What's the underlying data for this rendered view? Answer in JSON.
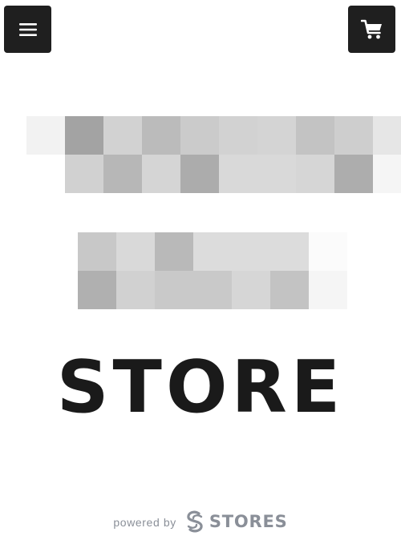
{
  "header": {
    "menu_icon": "hamburger-menu-icon",
    "cart_icon": "shopping-cart-icon"
  },
  "blurred_banner": {
    "rows_top": [
      [
        "#f2f2f2",
        "#a3a3a3",
        "#d2d2d2",
        "#bbbbbb",
        "#cbcbcb",
        "#d2d2d2",
        "#d4d4d4",
        "#c3c3c3",
        "#cecece",
        "#e6e6e6"
      ],
      [
        "#ffffff",
        "#d1d1d1",
        "#b7b7b7",
        "#d5d5d5",
        "#acacac",
        "#d9d9d9",
        "#d9d9d9",
        "#d6d6d6",
        "#adadad",
        "#f5f5f5"
      ]
    ],
    "rows_bottom": [
      [
        "#c8c8c8",
        "#d9d9d9",
        "#b9b9b9",
        "#dcdcdc",
        "#dcdcdc",
        "#dcdcdc",
        "#fbfbfb"
      ],
      [
        "#b0b0b0",
        "#d1d1d1",
        "#c9c9c9",
        "#c9c9c9",
        "#d6d6d6",
        "#c3c3c3",
        "#f5f5f5"
      ]
    ]
  },
  "main": {
    "store_title": "STORE"
  },
  "footer": {
    "powered_by": "powered by",
    "brand_name": "STORES",
    "brand_icon": "stores-logo-icon",
    "text_color": "#8a8f98"
  },
  "colors": {
    "button_bg": "#1f1f1f",
    "title_color": "#1a1a1a"
  }
}
